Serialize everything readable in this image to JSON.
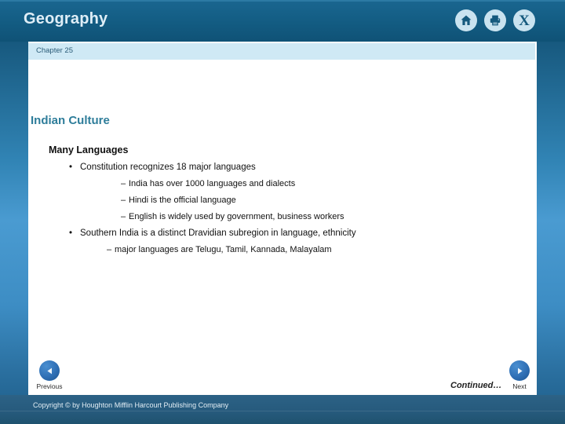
{
  "header": {
    "title": "Geography",
    "icons": [
      {
        "name": "home-icon",
        "label": "Home"
      },
      {
        "name": "print-icon",
        "label": "Print"
      },
      {
        "name": "close-icon",
        "label": "X"
      }
    ]
  },
  "chapter": {
    "label": "Chapter 25"
  },
  "slide": {
    "heading": "Indian Culture",
    "outline": [
      {
        "level": 1,
        "text": "Many Languages"
      },
      {
        "level": 2,
        "bullet": "•",
        "text": "Constitution recognizes 18 major languages"
      },
      {
        "level": 3,
        "bullet": "–",
        "text": "India has over 1000 languages and dialects"
      },
      {
        "level": 3,
        "bullet": "–",
        "text": "Hindi is the official language"
      },
      {
        "level": 3,
        "bullet": "–",
        "text": "English is widely used by government, business workers"
      },
      {
        "level": 2,
        "bullet": "•",
        "text": "Southern India is a distinct Dravidian subregion in language, ethnicity"
      },
      {
        "level": 3,
        "bullet": "–",
        "text": "major languages are Telugu, Tamil, Kannada, Malayalam"
      }
    ]
  },
  "navigation": {
    "previous_label": "Previous",
    "next_label": "Next",
    "continued_label": "Continued…"
  },
  "footer": {
    "copyright": "Copyright © by Houghton Mifflin Harcourt Publishing Company"
  },
  "colors": {
    "header_blue": "#145e85",
    "edge_blue": "#3d8dc4",
    "chapter_bar": "#cfe9f5",
    "heading_teal": "#2e7d9a",
    "footer_blue": "#2c6286",
    "nav_button": "#2f6fb5"
  }
}
